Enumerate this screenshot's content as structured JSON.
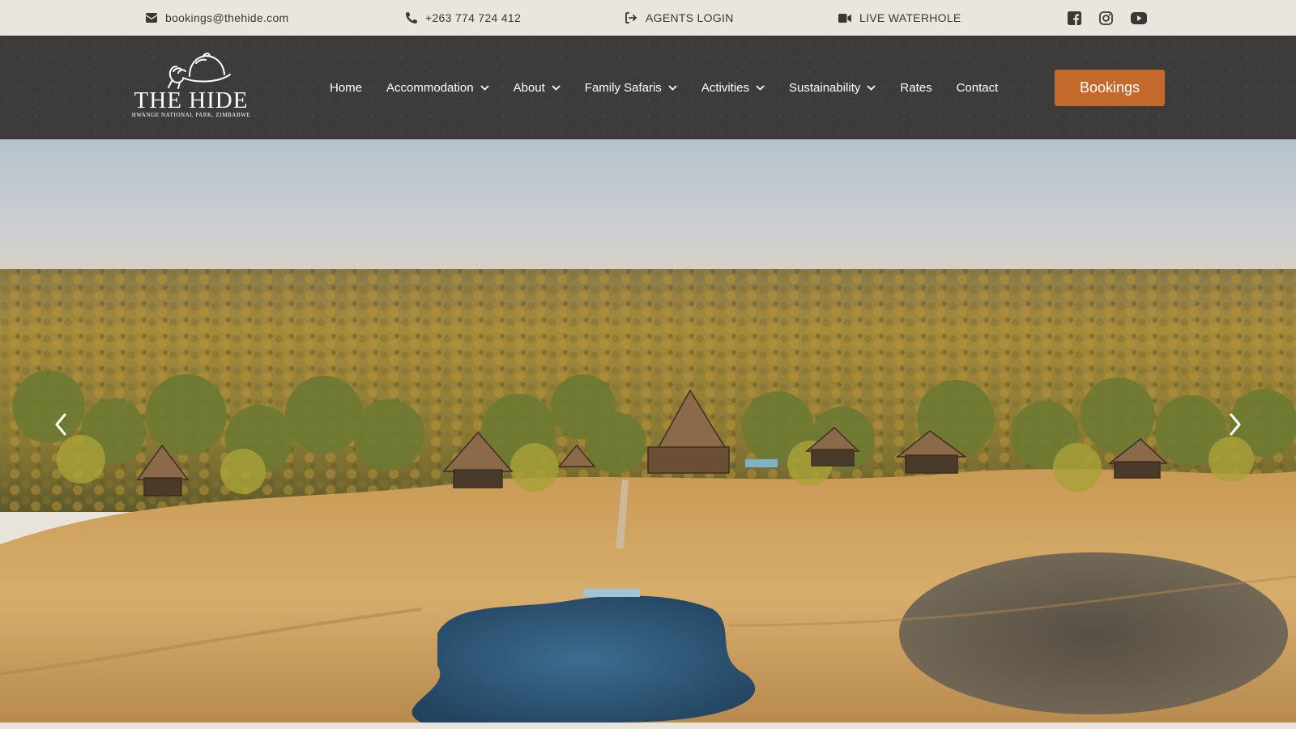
{
  "topbar": {
    "email": "bookings@thehide.com",
    "email_icon": "envelope-icon",
    "phone": "+263 774 724 412",
    "phone_icon": "phone-icon",
    "agents_login": "AGENTS LOGIN",
    "agents_icon": "sign-in-icon",
    "live_waterhole": "LIVE WATERHOLE",
    "live_icon": "video-camera-icon",
    "social": [
      "facebook-icon",
      "instagram-icon",
      "youtube-icon"
    ]
  },
  "logo": {
    "name": "THE HIDE",
    "subtitle": "HWANGE NATIONAL PARK, ZIMBABWE"
  },
  "nav": {
    "items": [
      {
        "label": "Home",
        "dropdown": false
      },
      {
        "label": "Accommodation",
        "dropdown": true
      },
      {
        "label": "About",
        "dropdown": true
      },
      {
        "label": "Family Safaris",
        "dropdown": true
      },
      {
        "label": "Activities",
        "dropdown": true
      },
      {
        "label": "Sustainability",
        "dropdown": true
      },
      {
        "label": "Rates",
        "dropdown": false
      },
      {
        "label": "Contact",
        "dropdown": false
      }
    ],
    "cta": "Bookings"
  },
  "colors": {
    "topbar_bg": "#e9e6dd",
    "navbar_bg": "#3e3c3a",
    "accent": "#c4692c"
  },
  "hero": {
    "prev_icon": "chevron-left-icon",
    "next_icon": "chevron-right-icon"
  }
}
